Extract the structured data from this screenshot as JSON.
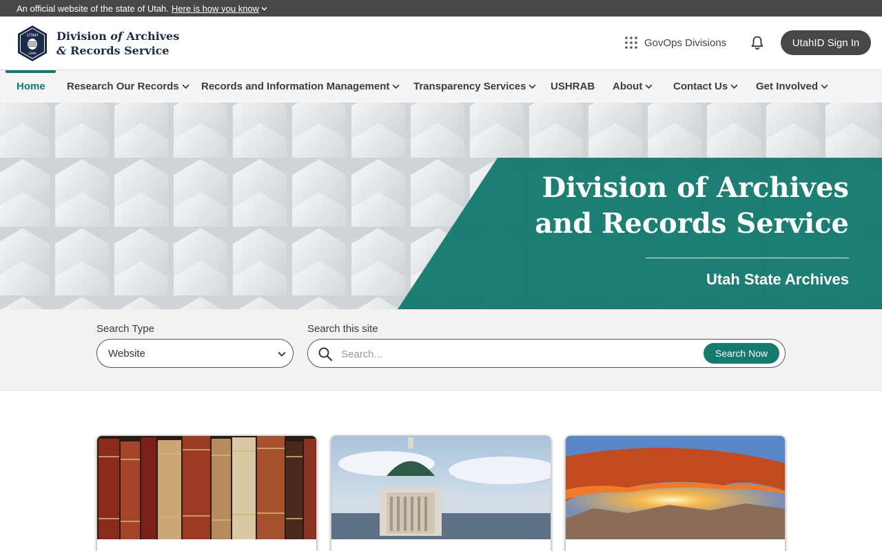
{
  "official_bar": {
    "text": "An official website of the state of Utah.",
    "link": "Here is how you know"
  },
  "header": {
    "logo_line1_a": "Division ",
    "logo_line1_b": "of",
    "logo_line1_c": " Archives",
    "logo_line2_a": "&",
    "logo_line2_b": " Records Service",
    "badge_top": "UTAH",
    "badge_bottom": "1896",
    "govops_label": "GovOps Divisions",
    "signin_label": "UtahID Sign In"
  },
  "nav": {
    "items": [
      {
        "label": "Home",
        "dropdown": false
      },
      {
        "label": "Research Our Records",
        "dropdown": true
      },
      {
        "label": "Records and Information Management",
        "dropdown": true
      },
      {
        "label": "Transparency Services",
        "dropdown": true
      },
      {
        "label": "USHRAB",
        "dropdown": false
      },
      {
        "label": "About",
        "dropdown": true
      },
      {
        "label": "Contact Us",
        "dropdown": true
      },
      {
        "label": "Get Involved",
        "dropdown": true
      }
    ]
  },
  "hero": {
    "title_line1": "Division of Archives",
    "title_line2": "and Records Service",
    "subtitle": "Utah State Archives"
  },
  "search": {
    "type_label": "Search Type",
    "type_value": "Website",
    "site_label": "Search this site",
    "placeholder": "Search...",
    "button": "Search Now"
  },
  "colors": {
    "accent": "#157a6e",
    "topbar": "#474747",
    "navy": "#1c2a4a"
  }
}
